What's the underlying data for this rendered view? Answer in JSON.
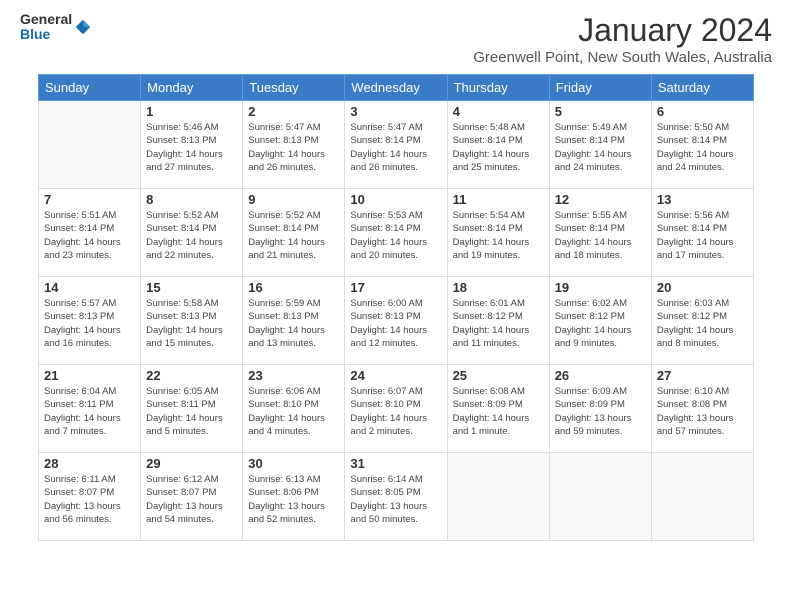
{
  "logo": {
    "general": "General",
    "blue": "Blue"
  },
  "title": "January 2024",
  "subtitle": "Greenwell Point, New South Wales, Australia",
  "days_header": [
    "Sunday",
    "Monday",
    "Tuesday",
    "Wednesday",
    "Thursday",
    "Friday",
    "Saturday"
  ],
  "weeks": [
    [
      {
        "day": "",
        "info": ""
      },
      {
        "day": "1",
        "info": "Sunrise: 5:46 AM\nSunset: 8:13 PM\nDaylight: 14 hours\nand 27 minutes."
      },
      {
        "day": "2",
        "info": "Sunrise: 5:47 AM\nSunset: 8:13 PM\nDaylight: 14 hours\nand 26 minutes."
      },
      {
        "day": "3",
        "info": "Sunrise: 5:47 AM\nSunset: 8:14 PM\nDaylight: 14 hours\nand 26 minutes."
      },
      {
        "day": "4",
        "info": "Sunrise: 5:48 AM\nSunset: 8:14 PM\nDaylight: 14 hours\nand 25 minutes."
      },
      {
        "day": "5",
        "info": "Sunrise: 5:49 AM\nSunset: 8:14 PM\nDaylight: 14 hours\nand 24 minutes."
      },
      {
        "day": "6",
        "info": "Sunrise: 5:50 AM\nSunset: 8:14 PM\nDaylight: 14 hours\nand 24 minutes."
      }
    ],
    [
      {
        "day": "7",
        "info": "Sunrise: 5:51 AM\nSunset: 8:14 PM\nDaylight: 14 hours\nand 23 minutes."
      },
      {
        "day": "8",
        "info": "Sunrise: 5:52 AM\nSunset: 8:14 PM\nDaylight: 14 hours\nand 22 minutes."
      },
      {
        "day": "9",
        "info": "Sunrise: 5:52 AM\nSunset: 8:14 PM\nDaylight: 14 hours\nand 21 minutes."
      },
      {
        "day": "10",
        "info": "Sunrise: 5:53 AM\nSunset: 8:14 PM\nDaylight: 14 hours\nand 20 minutes."
      },
      {
        "day": "11",
        "info": "Sunrise: 5:54 AM\nSunset: 8:14 PM\nDaylight: 14 hours\nand 19 minutes."
      },
      {
        "day": "12",
        "info": "Sunrise: 5:55 AM\nSunset: 8:14 PM\nDaylight: 14 hours\nand 18 minutes."
      },
      {
        "day": "13",
        "info": "Sunrise: 5:56 AM\nSunset: 8:14 PM\nDaylight: 14 hours\nand 17 minutes."
      }
    ],
    [
      {
        "day": "14",
        "info": "Sunrise: 5:57 AM\nSunset: 8:13 PM\nDaylight: 14 hours\nand 16 minutes."
      },
      {
        "day": "15",
        "info": "Sunrise: 5:58 AM\nSunset: 8:13 PM\nDaylight: 14 hours\nand 15 minutes."
      },
      {
        "day": "16",
        "info": "Sunrise: 5:59 AM\nSunset: 8:13 PM\nDaylight: 14 hours\nand 13 minutes."
      },
      {
        "day": "17",
        "info": "Sunrise: 6:00 AM\nSunset: 8:13 PM\nDaylight: 14 hours\nand 12 minutes."
      },
      {
        "day": "18",
        "info": "Sunrise: 6:01 AM\nSunset: 8:12 PM\nDaylight: 14 hours\nand 11 minutes."
      },
      {
        "day": "19",
        "info": "Sunrise: 6:02 AM\nSunset: 8:12 PM\nDaylight: 14 hours\nand 9 minutes."
      },
      {
        "day": "20",
        "info": "Sunrise: 6:03 AM\nSunset: 8:12 PM\nDaylight: 14 hours\nand 8 minutes."
      }
    ],
    [
      {
        "day": "21",
        "info": "Sunrise: 6:04 AM\nSunset: 8:11 PM\nDaylight: 14 hours\nand 7 minutes."
      },
      {
        "day": "22",
        "info": "Sunrise: 6:05 AM\nSunset: 8:11 PM\nDaylight: 14 hours\nand 5 minutes."
      },
      {
        "day": "23",
        "info": "Sunrise: 6:06 AM\nSunset: 8:10 PM\nDaylight: 14 hours\nand 4 minutes."
      },
      {
        "day": "24",
        "info": "Sunrise: 6:07 AM\nSunset: 8:10 PM\nDaylight: 14 hours\nand 2 minutes."
      },
      {
        "day": "25",
        "info": "Sunrise: 6:08 AM\nSunset: 8:09 PM\nDaylight: 14 hours\nand 1 minute."
      },
      {
        "day": "26",
        "info": "Sunrise: 6:09 AM\nSunset: 8:09 PM\nDaylight: 13 hours\nand 59 minutes."
      },
      {
        "day": "27",
        "info": "Sunrise: 6:10 AM\nSunset: 8:08 PM\nDaylight: 13 hours\nand 57 minutes."
      }
    ],
    [
      {
        "day": "28",
        "info": "Sunrise: 6:11 AM\nSunset: 8:07 PM\nDaylight: 13 hours\nand 56 minutes."
      },
      {
        "day": "29",
        "info": "Sunrise: 6:12 AM\nSunset: 8:07 PM\nDaylight: 13 hours\nand 54 minutes."
      },
      {
        "day": "30",
        "info": "Sunrise: 6:13 AM\nSunset: 8:06 PM\nDaylight: 13 hours\nand 52 minutes."
      },
      {
        "day": "31",
        "info": "Sunrise: 6:14 AM\nSunset: 8:05 PM\nDaylight: 13 hours\nand 50 minutes."
      },
      {
        "day": "",
        "info": ""
      },
      {
        "day": "",
        "info": ""
      },
      {
        "day": "",
        "info": ""
      }
    ]
  ]
}
